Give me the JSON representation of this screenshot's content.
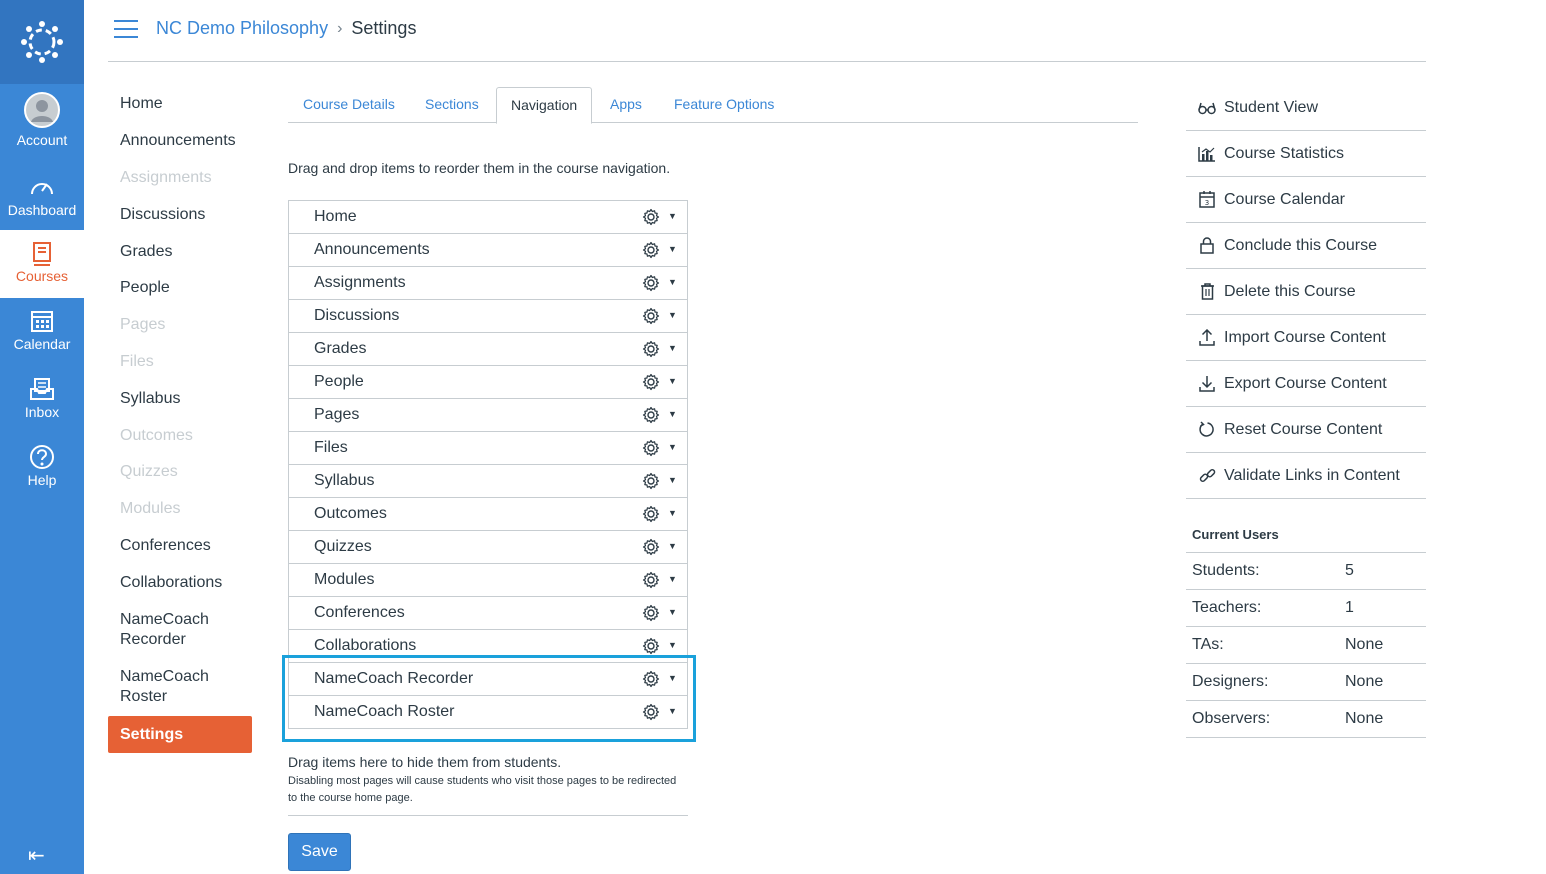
{
  "global_nav": {
    "items": [
      {
        "label": "Account",
        "icon": "avatar-icon"
      },
      {
        "label": "Dashboard",
        "icon": "speedometer-icon"
      },
      {
        "label": "Courses",
        "icon": "book-icon"
      },
      {
        "label": "Calendar",
        "icon": "calendar-icon"
      },
      {
        "label": "Inbox",
        "icon": "inbox-icon"
      },
      {
        "label": "Help",
        "icon": "question-icon"
      }
    ],
    "collapse_glyph": "⇤"
  },
  "breadcrumb": {
    "course": "NC Demo Philosophy",
    "separator": "›",
    "current": "Settings"
  },
  "course_nav": [
    {
      "label": "Home"
    },
    {
      "label": "Announcements"
    },
    {
      "label": "Assignments"
    },
    {
      "label": "Discussions"
    },
    {
      "label": "Grades"
    },
    {
      "label": "People"
    },
    {
      "label": "Pages"
    },
    {
      "label": "Files"
    },
    {
      "label": "Syllabus"
    },
    {
      "label": "Outcomes"
    },
    {
      "label": "Quizzes"
    },
    {
      "label": "Modules"
    },
    {
      "label": "Conferences"
    },
    {
      "label": "Collaborations"
    },
    {
      "label": "NameCoach Recorder"
    },
    {
      "label": "NameCoach Roster"
    },
    {
      "label": "Settings"
    }
  ],
  "tabs": [
    "Course Details",
    "Sections",
    "Navigation",
    "Apps",
    "Feature Options"
  ],
  "instructions": "Drag and drop items to reorder them in the course navigation.",
  "nav_items": [
    "Home",
    "Announcements",
    "Assignments",
    "Discussions",
    "Grades",
    "People",
    "Pages",
    "Files",
    "Syllabus",
    "Outcomes",
    "Quizzes",
    "Modules",
    "Conferences",
    "Collaborations",
    "NameCoach Recorder",
    "NameCoach Roster"
  ],
  "hidden_zone": {
    "title": "Drag items here to hide them from students.",
    "note_line1": "Disabling most pages will cause students who visit those pages to be redirected",
    "note_line2": "to the course home page."
  },
  "save_label": "Save",
  "sidebar_actions": [
    {
      "label": "Student View",
      "icon": "glasses-icon"
    },
    {
      "label": "Course Statistics",
      "icon": "statistics-icon"
    },
    {
      "label": "Course Calendar",
      "icon": "calendar-icon"
    },
    {
      "label": "Conclude this Course",
      "icon": "lock-icon"
    },
    {
      "label": "Delete this Course",
      "icon": "trash-icon"
    },
    {
      "label": "Import Course Content",
      "icon": "upload-icon"
    },
    {
      "label": "Export Course Content",
      "icon": "download-icon"
    },
    {
      "label": "Reset Course Content",
      "icon": "reset-icon"
    },
    {
      "label": "Validate Links in Content",
      "icon": "link-icon"
    }
  ],
  "current_users": {
    "title": "Current Users",
    "rows": [
      {
        "label": "Students:",
        "value": "5"
      },
      {
        "label": "Teachers:",
        "value": "1"
      },
      {
        "label": "TAs:",
        "value": "None"
      },
      {
        "label": "Designers:",
        "value": "None"
      },
      {
        "label": "Observers:",
        "value": "None"
      }
    ]
  },
  "colors": {
    "brand_blue": "#3b87d6",
    "accent_orange": "#e66135",
    "highlight_cyan": "#1aa1db"
  }
}
